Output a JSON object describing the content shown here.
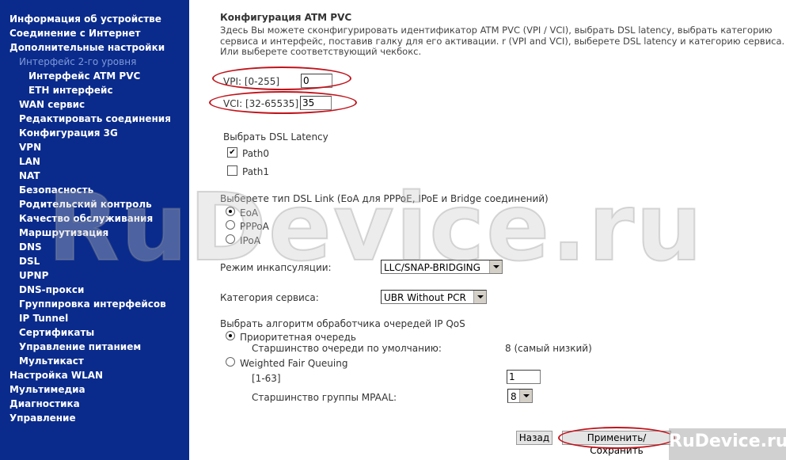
{
  "sidebar": {
    "items": [
      {
        "label": "Информация об устройстве",
        "level": 0
      },
      {
        "label": "Соединение с Интернет",
        "level": 0
      },
      {
        "label": "Дополнительные настройки",
        "level": 0
      },
      {
        "label": "Интерфейс 2-го уровня",
        "level": 1,
        "active": true
      },
      {
        "label": "Интерфейс ATM PVC",
        "level": 2
      },
      {
        "label": "ETH интерфейс",
        "level": 2
      },
      {
        "label": "WAN сервис",
        "level": 1
      },
      {
        "label": "Редактировать соединения",
        "level": 1
      },
      {
        "label": "Конфигурация 3G",
        "level": 1
      },
      {
        "label": "VPN",
        "level": 1
      },
      {
        "label": "LAN",
        "level": 1
      },
      {
        "label": "NAT",
        "level": 1
      },
      {
        "label": "Безопасность",
        "level": 1
      },
      {
        "label": "Родительский контроль",
        "level": 1
      },
      {
        "label": "Качество обслуживания",
        "level": 1
      },
      {
        "label": "Маршрутизация",
        "level": 1
      },
      {
        "label": "DNS",
        "level": 1
      },
      {
        "label": "DSL",
        "level": 1
      },
      {
        "label": "UPNP",
        "level": 1
      },
      {
        "label": "DNS-прокси",
        "level": 1
      },
      {
        "label": "Группировка интерфейсов",
        "level": 1
      },
      {
        "label": "IP Tunnel",
        "level": 1
      },
      {
        "label": "Сертификаты",
        "level": 1
      },
      {
        "label": "Управление питанием",
        "level": 1
      },
      {
        "label": "Мультикаст",
        "level": 1
      },
      {
        "label": "Настройка WLAN",
        "level": 0
      },
      {
        "label": "Мультимедиа",
        "level": 0
      },
      {
        "label": "Диагностика",
        "level": 0
      },
      {
        "label": "Управление",
        "level": 0
      }
    ]
  },
  "page": {
    "title": "Конфигурация ATM PVC",
    "description": "Здесь Вы можете сконфигурировать идентификатор ATM PVC (VPI / VCI), выбрать DSL latency, выбрать категорию сервиса и интерфейс, поставив галку для его активации. r (VPI and VCI), выберете DSL latency и категорию сервиса. Или выберете соответствующий чекбокс."
  },
  "vpi": {
    "label": "VPI: [0-255]",
    "value": "0"
  },
  "vci": {
    "label": "VCI: [32-65535]",
    "value": "35"
  },
  "latency": {
    "label": "Выбрать DSL Latency",
    "path0": {
      "label": "Path0",
      "checked": true
    },
    "path1": {
      "label": "Path1",
      "checked": false
    }
  },
  "link_type": {
    "label": "Выберете тип DSL Link (EoA для PPPoE, IPoE и Bridge соединений)",
    "options": [
      {
        "label": "EoA",
        "selected": true
      },
      {
        "label": "PPPoA",
        "selected": false
      },
      {
        "label": "IPoA",
        "selected": false
      }
    ]
  },
  "encapsulation": {
    "label": "Режим инкапсуляции:",
    "selected": "LLC/SNAP-BRIDGING"
  },
  "service_category": {
    "label": "Категория сервиса:",
    "selected": "UBR Without PCR"
  },
  "qos": {
    "label": "Выбрать алгоритм обработчика очередей IP QoS",
    "priority": {
      "label": "Приоритетная очередь",
      "selected": true
    },
    "default_priority_label": "Старшинство очереди по умолчанию:",
    "default_priority_value": "8 (самый низкий)",
    "wfq": {
      "label": "Weighted Fair Queuing",
      "selected": false
    },
    "wfq_range_label": "[1-63]",
    "wfq_value": "1",
    "mpaal_label": "Старшинство группы MPAAL:",
    "mpaal_selected": "8"
  },
  "buttons": {
    "back": "Назад",
    "apply": "Применить/Сохранить"
  },
  "watermark": {
    "text": "RuDevice.ru",
    "corner": "RuDevice.ru"
  },
  "colors": {
    "sidebar_bg": "#0a2b8c",
    "highlight": "#c0141c"
  }
}
